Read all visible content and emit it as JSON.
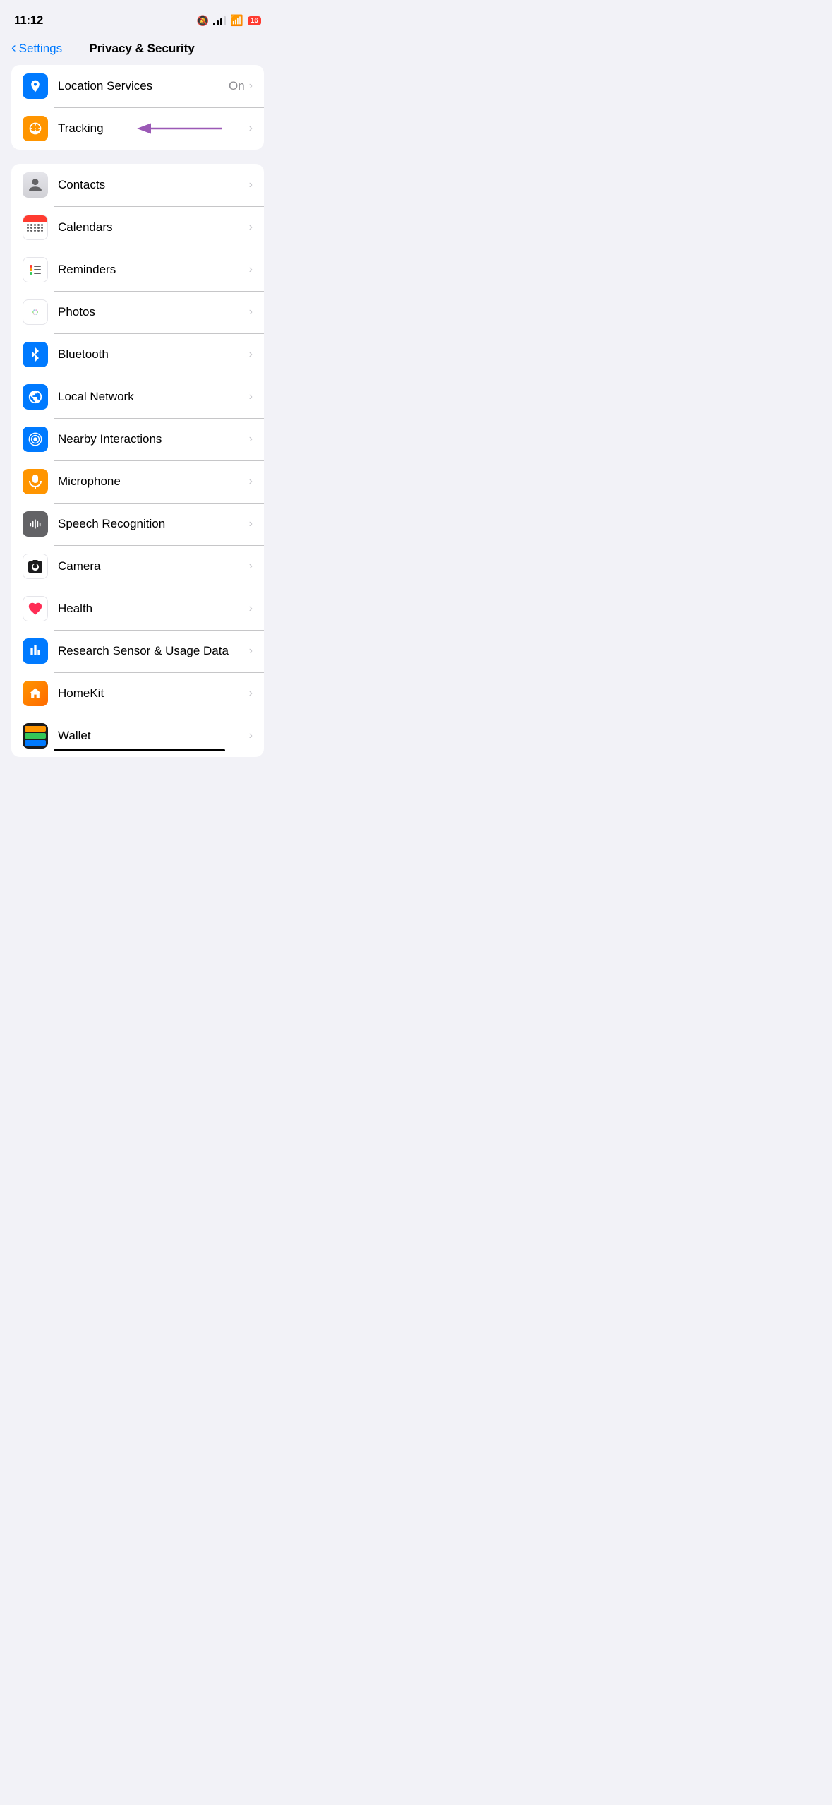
{
  "statusBar": {
    "time": "11:12",
    "batteryLevel": "16"
  },
  "navBar": {
    "backLabel": "Settings",
    "title": "Privacy & Security"
  },
  "topSection": {
    "rows": [
      {
        "id": "location-services",
        "label": "Location Services",
        "value": "On",
        "iconBg": "blue",
        "iconType": "location"
      },
      {
        "id": "tracking",
        "label": "Tracking",
        "value": "",
        "iconBg": "orange",
        "iconType": "tracking",
        "hasArrow": true
      }
    ]
  },
  "permissionsSection": {
    "rows": [
      {
        "id": "contacts",
        "label": "Contacts",
        "iconType": "contacts"
      },
      {
        "id": "calendars",
        "label": "Calendars",
        "iconType": "calendar"
      },
      {
        "id": "reminders",
        "label": "Reminders",
        "iconType": "reminders"
      },
      {
        "id": "photos",
        "label": "Photos",
        "iconType": "photos"
      },
      {
        "id": "bluetooth",
        "label": "Bluetooth",
        "iconType": "bluetooth",
        "iconBg": "blue"
      },
      {
        "id": "local-network",
        "label": "Local Network",
        "iconType": "globe",
        "iconBg": "blue"
      },
      {
        "id": "nearby-interactions",
        "label": "Nearby Interactions",
        "iconType": "nearby",
        "iconBg": "blue"
      },
      {
        "id": "microphone",
        "label": "Microphone",
        "iconType": "microphone",
        "iconBg": "orange"
      },
      {
        "id": "speech-recognition",
        "label": "Speech Recognition",
        "iconType": "waveform",
        "iconBg": "darkgray"
      },
      {
        "id": "camera",
        "label": "Camera",
        "iconType": "camera"
      },
      {
        "id": "health",
        "label": "Health",
        "iconType": "health"
      },
      {
        "id": "research",
        "label": "Research Sensor & Usage Data",
        "iconType": "research",
        "iconBg": "blue"
      },
      {
        "id": "homekit",
        "label": "HomeKit",
        "iconType": "homekit"
      },
      {
        "id": "wallet",
        "label": "Wallet",
        "iconType": "wallet"
      }
    ]
  },
  "chevron": "›",
  "backChevron": "‹"
}
